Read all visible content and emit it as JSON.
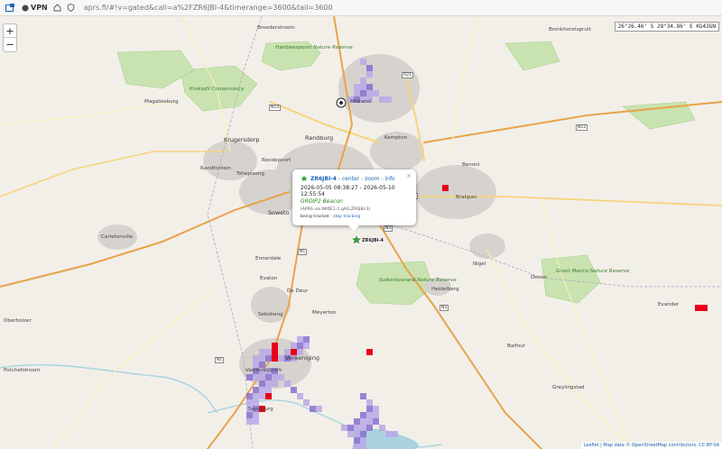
{
  "browser": {
    "vpn_label": "VPN",
    "url": "aprs.fi/#!v=gated&call=a%2FZR6JBI-4&timerange=3600&tail=3600"
  },
  "map": {
    "coordinate_readout": "26°26.46' S 28°34.86' E KG43GN",
    "zoom_in_label": "+",
    "zoom_out_label": "−",
    "attribution_prefix": "Leaflet",
    "attribution_rest": " | Map data © OpenStreetMap contributors, CC-BY-SA",
    "places": [
      {
        "text": "Broederstroom",
        "size": "sm"
      },
      {
        "text": "Hartbeespoort Nature Reserve",
        "size": "green"
      },
      {
        "text": "Krokodil Conservancy",
        "size": "green"
      },
      {
        "text": "Magaliesburg",
        "size": "sm"
      },
      {
        "text": "Krugersdorp",
        "size": "med"
      },
      {
        "text": "Randburg",
        "size": "med"
      },
      {
        "text": "Roodepoort",
        "size": "sm"
      },
      {
        "text": "Randfontein",
        "size": "sm"
      },
      {
        "text": "Soweto",
        "size": "med"
      },
      {
        "text": "Tshepisong",
        "size": "sm"
      },
      {
        "text": "Carletonville",
        "size": "sm"
      },
      {
        "text": "Midrand",
        "size": "sm"
      },
      {
        "text": "Kempton",
        "size": "sm"
      },
      {
        "text": "Bronkhorstspruit",
        "size": "sm"
      },
      {
        "text": "Benoni",
        "size": "sm"
      },
      {
        "text": "Brakpan",
        "size": "sm"
      },
      {
        "text": "Nigel",
        "size": "sm"
      },
      {
        "text": "Heidelberg",
        "size": "sm"
      },
      {
        "text": "Suikerbosrand Nature Reserve",
        "size": "green"
      },
      {
        "text": "De Deur",
        "size": "sm"
      },
      {
        "text": "Meyerton",
        "size": "sm"
      },
      {
        "text": "Evaton",
        "size": "sm"
      },
      {
        "text": "Sebokeng",
        "size": "sm"
      },
      {
        "text": "Vereeniging",
        "size": "med"
      },
      {
        "text": "Vanderbijlpark",
        "size": "sm"
      },
      {
        "text": "Sasolburg",
        "size": "sm"
      },
      {
        "text": "Balfour",
        "size": "sm"
      },
      {
        "text": "Greylingstad",
        "size": "sm"
      },
      {
        "text": "Devon",
        "size": "sm"
      },
      {
        "text": "Evander",
        "size": "sm"
      },
      {
        "text": "Potchefstroom",
        "size": "sm"
      },
      {
        "text": "Ennerdale",
        "size": "sm"
      },
      {
        "text": "Oberholzer",
        "size": "sm"
      },
      {
        "text": "Groot Marico Nature Reserve",
        "size": "green"
      }
    ],
    "road_shields": [
      "N14",
      "N1",
      "R21",
      "N12",
      "N17",
      "N3",
      "N1",
      "N3"
    ]
  },
  "station": {
    "callsign": "ZR6JBI-4",
    "marker_label": "ZR6JBI-4",
    "links": [
      "center",
      "zoom",
      "info"
    ],
    "times": "2026-05-05 08:38:27 - 2026-05-10 12:55:54",
    "comment": "GROIP2 Beacon",
    "via": "(APRS via WIDE1-1,qAO,ZR6JBI-3)",
    "tracking_text": "being tracked -",
    "stop_tracking": "stop tracking",
    "close_label": "×"
  },
  "heatmap": {
    "purple": "#8a6fd0",
    "purple_light": "#b9a8e6",
    "red": "#e8001a"
  }
}
